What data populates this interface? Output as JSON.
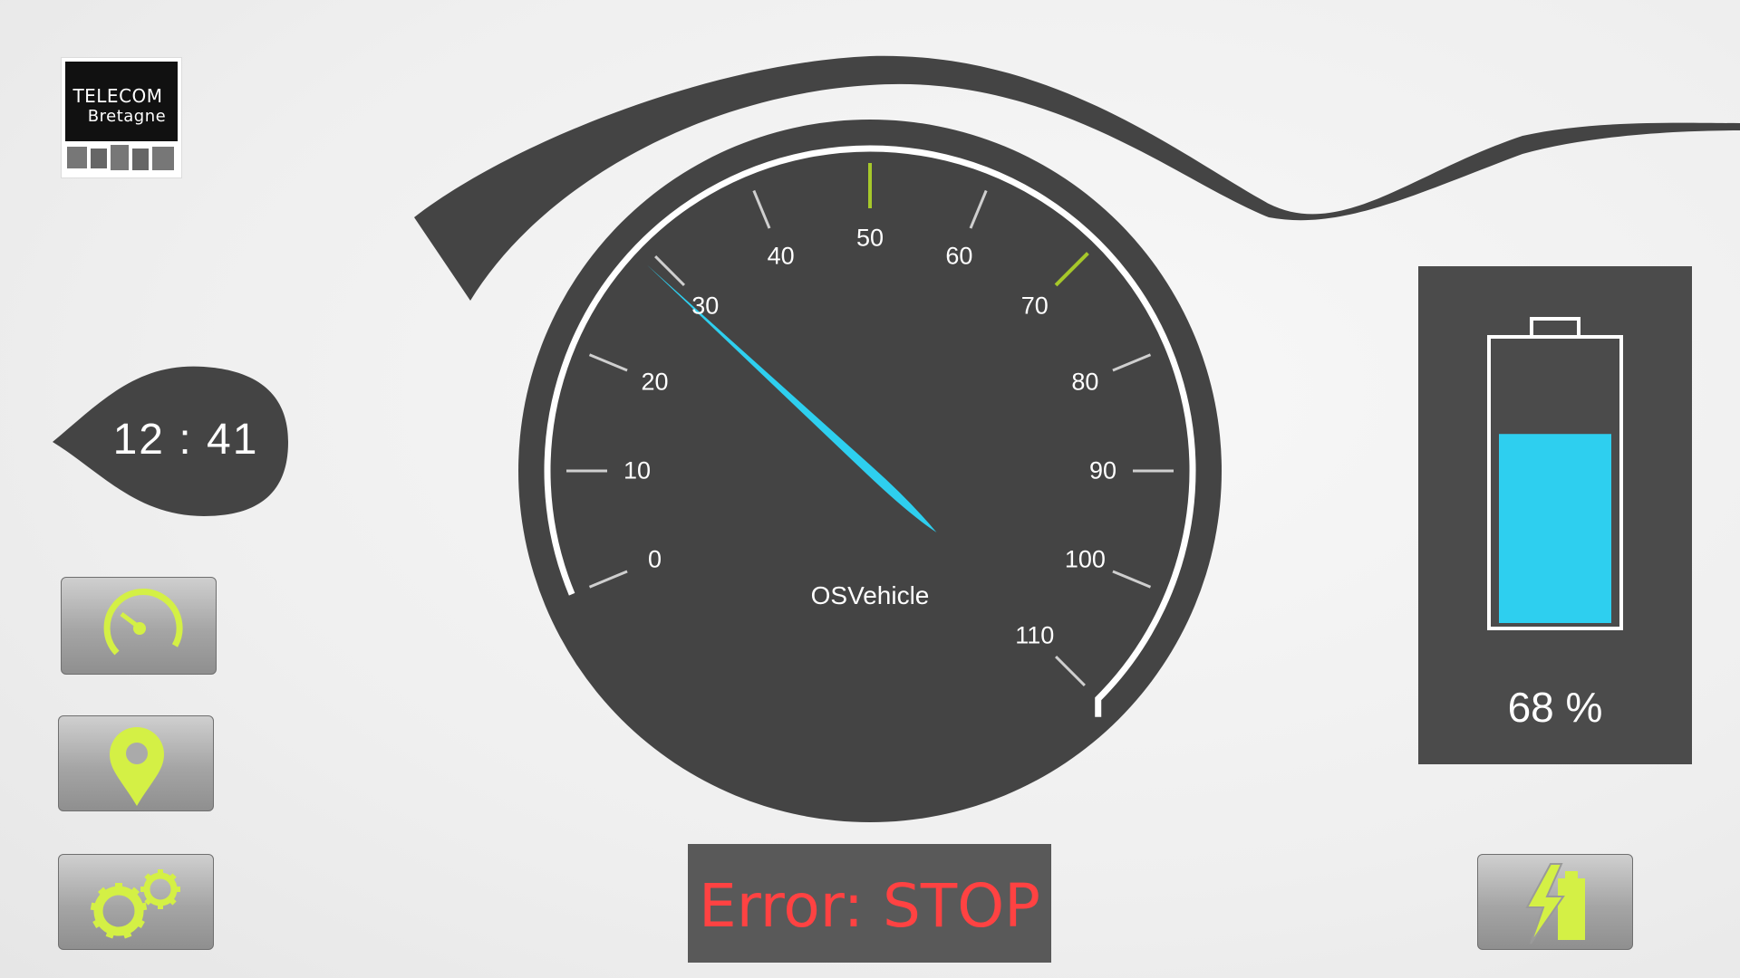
{
  "logo": {
    "line1": "TELECOM",
    "line2": "Bretagne"
  },
  "clock": {
    "time": "12 : 41"
  },
  "speedometer": {
    "brand": "OSVehicle",
    "min": 0,
    "max": 110,
    "tick_labels": [
      "0",
      "10",
      "20",
      "30",
      "40",
      "50",
      "60",
      "70",
      "80",
      "90",
      "100",
      "110"
    ],
    "highlighted_ticks": [
      "50",
      "70"
    ],
    "needle_value": 29,
    "needle_color": "#2ecfef",
    "highlight_color": "#a6c82a"
  },
  "error": {
    "text": "Error: STOP",
    "color": "#ff4242"
  },
  "battery": {
    "level_fraction": 0.68,
    "percent_text": "68 %",
    "fill_color": "#2ecfef"
  },
  "buttons": {
    "speed": {
      "icon": "speedometer-icon"
    },
    "map": {
      "icon": "map-pin-icon"
    },
    "settings": {
      "icon": "gears-icon"
    },
    "charge": {
      "icon": "battery-charge-icon"
    }
  },
  "colors": {
    "panel_dark": "#444444",
    "accent_green": "#d4f045",
    "white": "#ffffff"
  }
}
